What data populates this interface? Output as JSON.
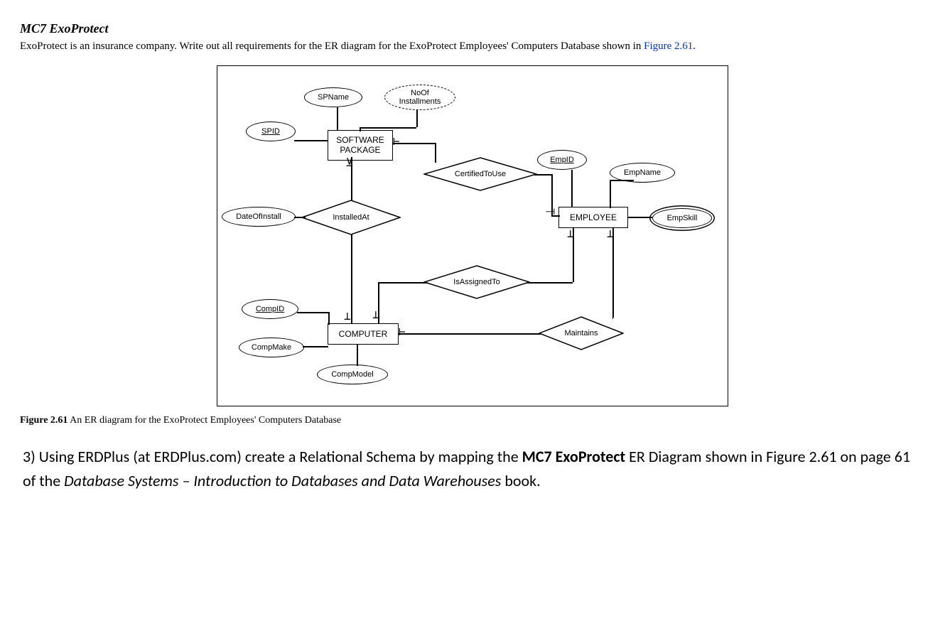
{
  "section_title": "MC7 ExoProtect",
  "intro": {
    "text_pre": "ExoProtect is an insurance company. Write out all requirements for the ER diagram for the ExoProtect Employees' Computers Database shown in ",
    "figure_link": "Figure 2.61",
    "text_post": "."
  },
  "diagram": {
    "entities": {
      "software_package": "SOFTWARE\nPACKAGE",
      "computer": "COMPUTER",
      "employee": "EMPLOYEE"
    },
    "attributes": {
      "spid": "SPID",
      "spname": "SPName",
      "noof_installments": "NoOf\nInstallments",
      "dateofinstall": "DateOfInstall",
      "compid": "CompID",
      "compmake": "CompMake",
      "compmodel": "CompModel",
      "empid": "EmpID",
      "empname": "EmpName",
      "empskill": "EmpSkill"
    },
    "relationships": {
      "certified_to_use": "CertifiedToUse",
      "installed_at": "InstalledAt",
      "is_assigned_to": "IsAssignedTo",
      "maintains": "Maintains"
    }
  },
  "caption": {
    "label": "Figure 2.61",
    "text": " An ER diagram for the ExoProtect Employees' Computers Database"
  },
  "question": {
    "num": "3) ",
    "t1": "Using ERDPlus (at ERDPlus.com) create a Relational Schema by mapping the ",
    "bold": "MC7 ExoProtect",
    "t2": " ER Diagram shown in Figure 2.61 on page 61 of the ",
    "ital": "Database Systems – Introduction to Databases and Data Warehouses",
    "t3": " book."
  }
}
